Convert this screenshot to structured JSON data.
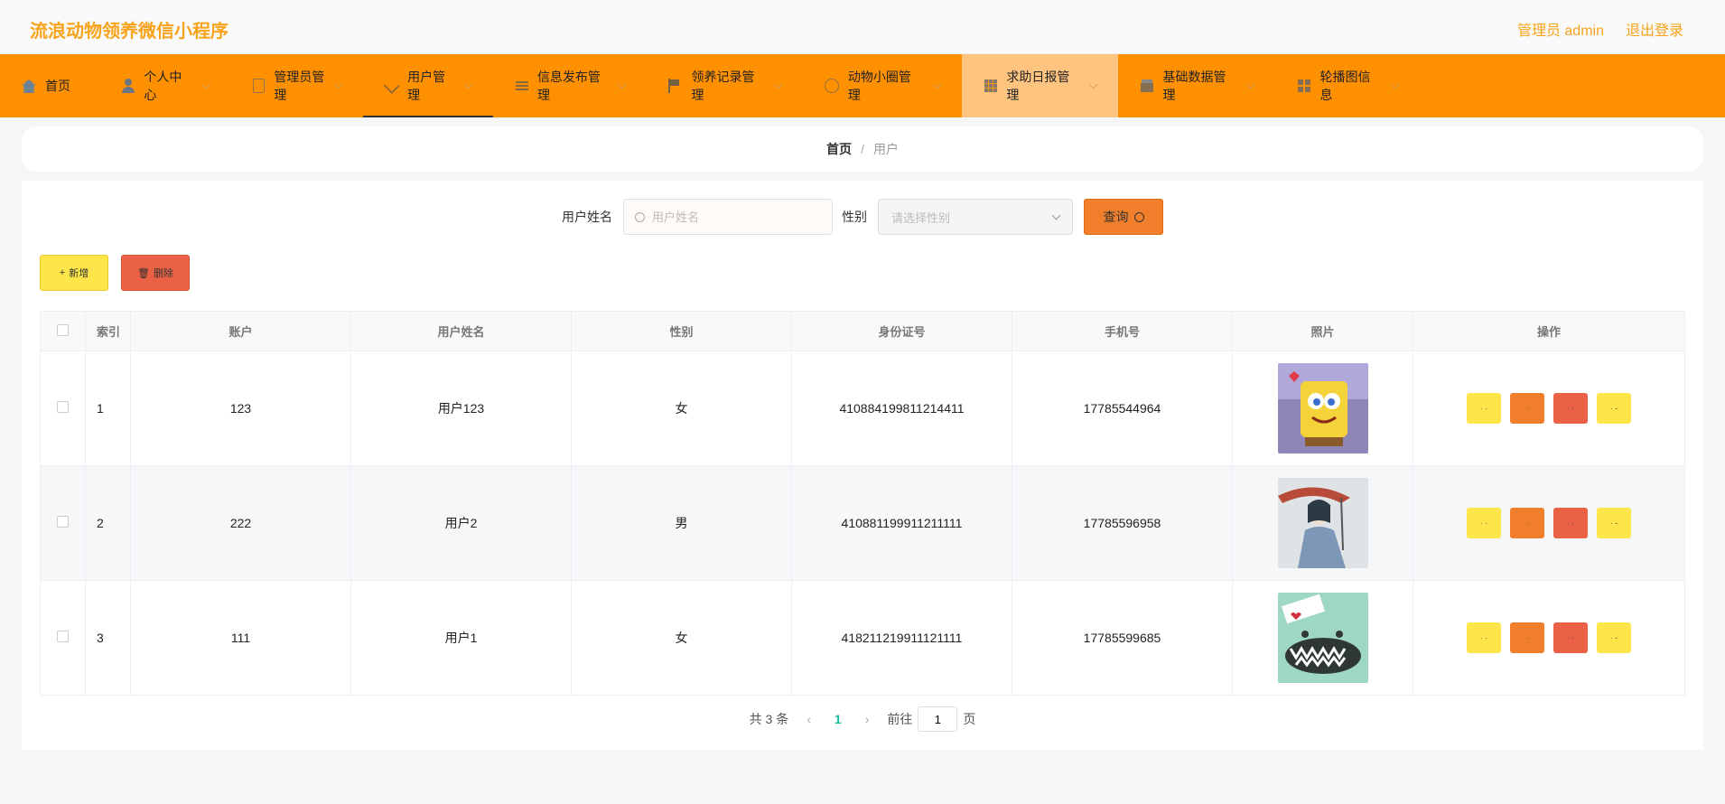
{
  "header": {
    "title": "流浪动物领养微信小程序",
    "admin_label": "管理员 admin",
    "logout_label": "退出登录"
  },
  "nav": {
    "items": [
      {
        "label": "首页",
        "icon": "home-icon"
      },
      {
        "label": "个人中心",
        "icon": "user-icon"
      },
      {
        "label": "管理员管理",
        "icon": "chart-icon"
      },
      {
        "label": "用户管理",
        "icon": "send-icon"
      },
      {
        "label": "信息发布管理",
        "icon": "list-icon"
      },
      {
        "label": "领养记录管理",
        "icon": "flag-icon"
      },
      {
        "label": "动物小圈管理",
        "icon": "compass-icon"
      },
      {
        "label": "求助日报管理",
        "icon": "grid-icon"
      },
      {
        "label": "基础数据管理",
        "icon": "shop-icon"
      },
      {
        "label": "轮播图信息",
        "icon": "apps-icon"
      }
    ]
  },
  "breadcrumb": {
    "home": "首页",
    "separator": "/",
    "current": "用户"
  },
  "search": {
    "name_label": "用户姓名",
    "name_placeholder": "用户姓名",
    "gender_label": "性别",
    "gender_placeholder": "请选择性别",
    "query_label": "查询"
  },
  "actions": {
    "add_label": "新增",
    "delete_label": "删除"
  },
  "table": {
    "columns": [
      "索引",
      "账户",
      "用户姓名",
      "性别",
      "身份证号",
      "手机号",
      "照片",
      "操作"
    ],
    "rows": [
      {
        "index": "1",
        "account": "123",
        "name": "用户123",
        "gender": "女",
        "id_number": "410884199811214411",
        "phone": "17785544964"
      },
      {
        "index": "2",
        "account": "222",
        "name": "用户2",
        "gender": "男",
        "id_number": "410881199911211111",
        "phone": "17785596958"
      },
      {
        "index": "3",
        "account": "111",
        "name": "用户1",
        "gender": "女",
        "id_number": "418211219911121111",
        "phone": "17785599685"
      }
    ]
  },
  "pagination": {
    "total_text": "共 3 条",
    "current_page": "1",
    "goto_label": "前往",
    "goto_value": "1",
    "page_suffix": "页"
  },
  "colors": {
    "brand": "#f7a31b",
    "nav_bg": "#ff9000",
    "nav_highlight": "#ffc47f",
    "btn_yellow": "#fde54a",
    "btn_orange": "#f07e2a",
    "btn_red": "#eb6145"
  }
}
